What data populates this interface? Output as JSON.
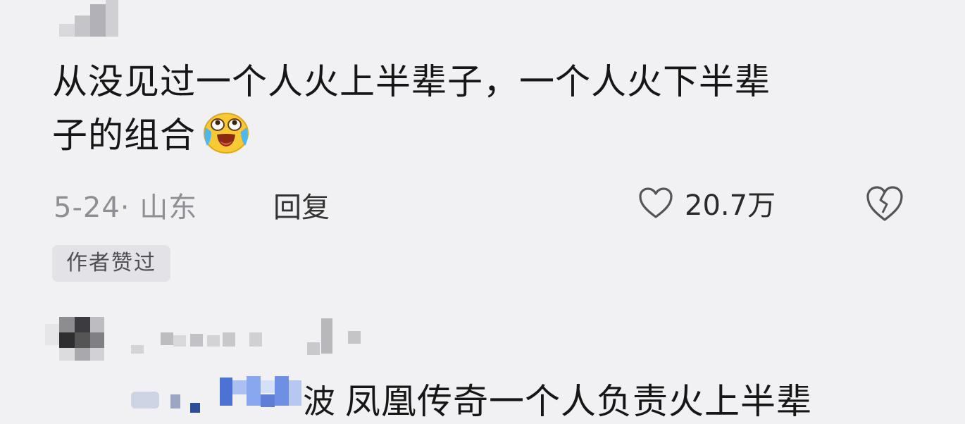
{
  "comment": {
    "text_line1": "从没见过一个人火上半辈子，一个人火下半辈",
    "text_line2": "子的组合",
    "emoji": "crying-laughing-emoji",
    "date_location": "5-24· 山东",
    "reply_label": "回复",
    "like_count": "20.7万",
    "author_badge": "作者赞过"
  },
  "reply": {
    "username_tail": "波",
    "text": "凤凰传奇一个人负责火上半辈"
  },
  "colors": {
    "background": "#f1f1f3",
    "meta_text": "#8e8e94",
    "badge_bg": "#e3e3e7",
    "emoji_yellow": "#f7c934",
    "emoji_tears": "#4fb6ee"
  },
  "icons": {
    "like": "heart-outline-icon",
    "dislike": "broken-heart-icon"
  }
}
